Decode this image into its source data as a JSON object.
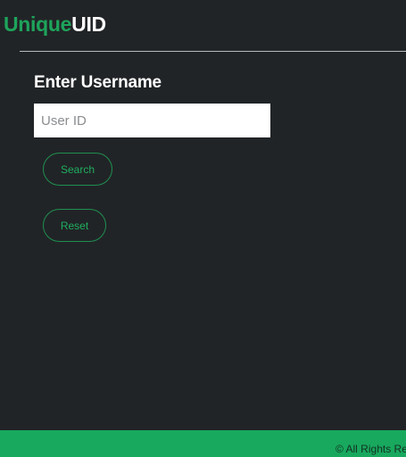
{
  "brand": {
    "part1": "Unique",
    "part2": "UID"
  },
  "form": {
    "heading": "Enter Username",
    "input_placeholder": "User ID",
    "input_value": "",
    "search_label": "Search",
    "reset_label": "Reset"
  },
  "footer": {
    "text": "© All Rights Res"
  },
  "colors": {
    "background": "#212427",
    "accent": "#1ea45b",
    "footer": "#18a95e",
    "text": "#ffffff"
  }
}
